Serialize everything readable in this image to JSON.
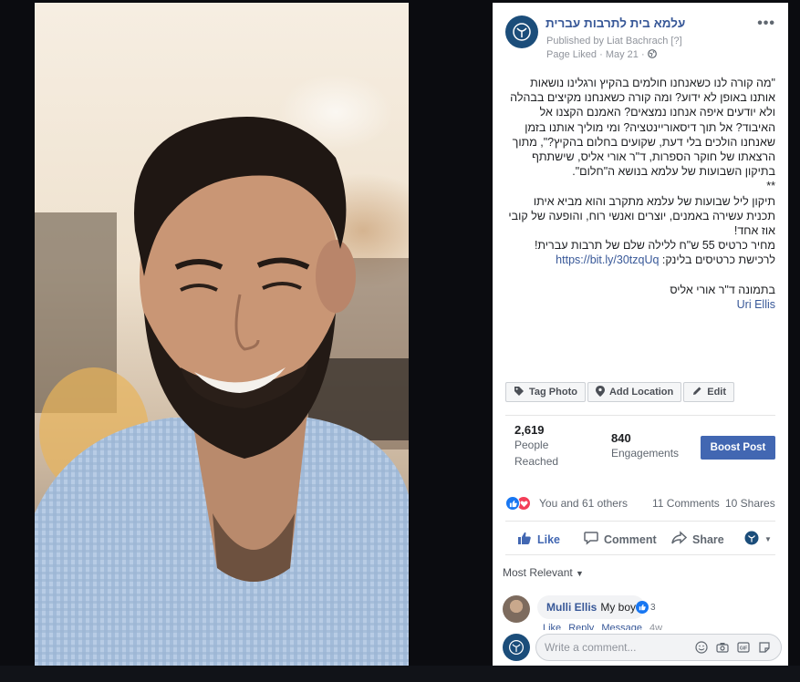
{
  "page": {
    "name": "עלמא בית לתרבות עברית",
    "published_prefix": "Published by",
    "publisher": "Liat Bachrach",
    "help_marker": "[?]",
    "status": "Page Liked",
    "date": "May 21",
    "more_label": "•••"
  },
  "post": {
    "paragraphs": [
      "\"מה קורה לנו כשאנחנו חולמים בהקיץ ורגלינו נושאות אותנו באופן לא ידוע? ומה קורה כשאנחנו מקיצים בבהלה ולא יודעים איפה אנחנו נמצאים? האמנם הקצנו אל האיבוד? אל תוך דיסאוריינטציה? ומי מוליך אותנו בזמן שאנחנו הולכים בלי דעת, שקועים בחלום בהקיץ?\", מתוך הרצאתו של חוקר הספרות, ד\"ר אורי אליס, שישתתף בתיקון השבועות של עלמא בנושא ה\"חלום\".",
      "**",
      "תיקון ליל שבועות של עלמא מתקרב והוא מביא איתו תכנית עשירה באמנים, יוצרים ואנשי רוח, והופעה של קובי אוז אחד!",
      "מחיר כרטיס 55 ש\"ח ללילה שלם של תרבות עברית!"
    ],
    "link_prefix": "לרכישת כרטיסים בלינק:",
    "link": "https://bit.ly/30tzqUq",
    "caption": "בתמונה ד\"ר אורי אליס",
    "tag": "Uri Ellis"
  },
  "photo_actions": {
    "tag_photo": "Tag Photo",
    "add_location": "Add Location",
    "edit": "Edit"
  },
  "stats": {
    "reached_value": "2,619",
    "reached_label": "People Reached",
    "engagements_value": "840",
    "engagements_label": "Engagements",
    "boost_label": "Boost Post"
  },
  "reactions": {
    "summary": "You and 61 others",
    "comments": "11 Comments",
    "shares": "10 Shares"
  },
  "action_bar": {
    "like": "Like",
    "comment": "Comment",
    "share": "Share"
  },
  "comments_section": {
    "sort_label": "Most Relevant",
    "comment": {
      "author": "Mulli Ellis",
      "text": "My boy",
      "like_count": "3",
      "like_link": "Like",
      "reply_link": "Reply",
      "message_link": "Message",
      "time": "4w"
    },
    "write_placeholder": "Write a comment..."
  },
  "colors": {
    "brand_blue": "#385898",
    "button_blue": "#4267b2",
    "page_logo": "#1b4d7a"
  }
}
